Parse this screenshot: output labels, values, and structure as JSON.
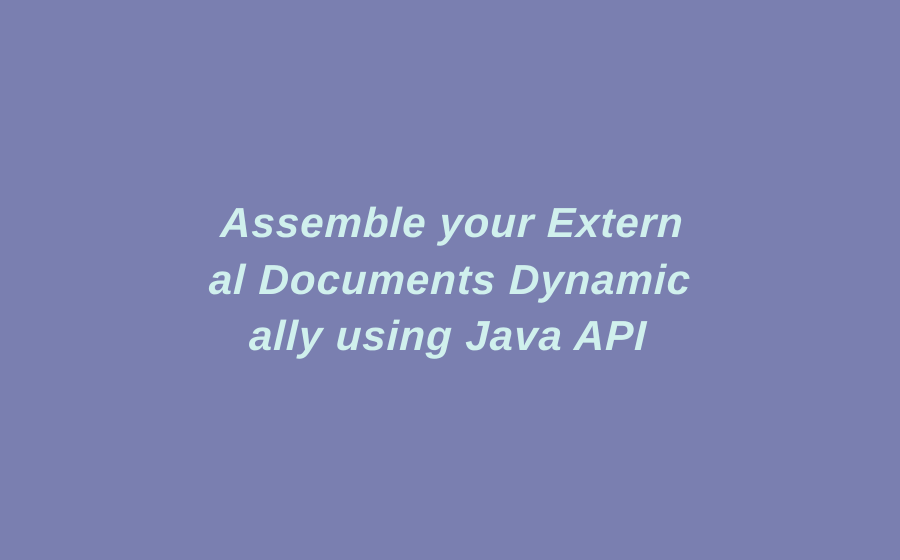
{
  "banner": {
    "line1": "Assemble your Extern",
    "line2": "al Documents Dynamic",
    "line3": "ally using Java API"
  },
  "colors": {
    "background": "#7a7fb0",
    "text": "#d0f0ed"
  }
}
